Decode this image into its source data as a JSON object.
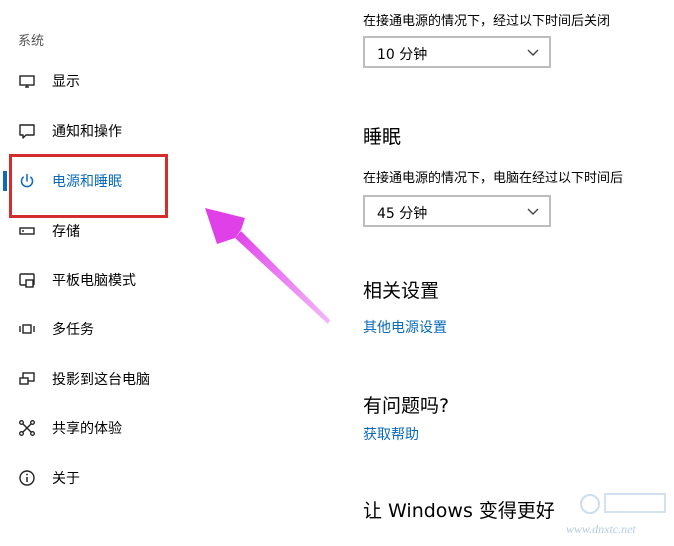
{
  "sidebar": {
    "heading": "系统",
    "items": [
      {
        "label": "显示",
        "icon": "monitor-icon"
      },
      {
        "label": "通知和操作",
        "icon": "notification-icon"
      },
      {
        "label": "电源和睡眠",
        "icon": "power-icon",
        "selected": true
      },
      {
        "label": "存储",
        "icon": "storage-icon"
      },
      {
        "label": "平板电脑模式",
        "icon": "tablet-mode-icon"
      },
      {
        "label": "多任务",
        "icon": "multitasking-icon"
      },
      {
        "label": "投影到这台电脑",
        "icon": "project-icon"
      },
      {
        "label": "共享的体验",
        "icon": "shared-experiences-icon"
      },
      {
        "label": "关于",
        "icon": "info-icon"
      }
    ]
  },
  "main": {
    "screen": {
      "desc": "在接通电源的情况下，经过以下时间后关闭",
      "value": "10 分钟"
    },
    "sleep": {
      "title": "睡眠",
      "desc": "在接通电源的情况下，电脑在经过以下时间后",
      "value": "45 分钟"
    },
    "related": {
      "title": "相关设置",
      "link": "其他电源设置"
    },
    "questions": {
      "title": "有问题吗?",
      "link": "获取帮助"
    },
    "improve": {
      "title": "让 Windows 变得更好"
    }
  },
  "watermark": {
    "url": "www.dnxtc.net"
  },
  "colors": {
    "accent": "#0a6bb8",
    "highlight_box": "#d42d2d",
    "arrow": "#e040e8"
  }
}
